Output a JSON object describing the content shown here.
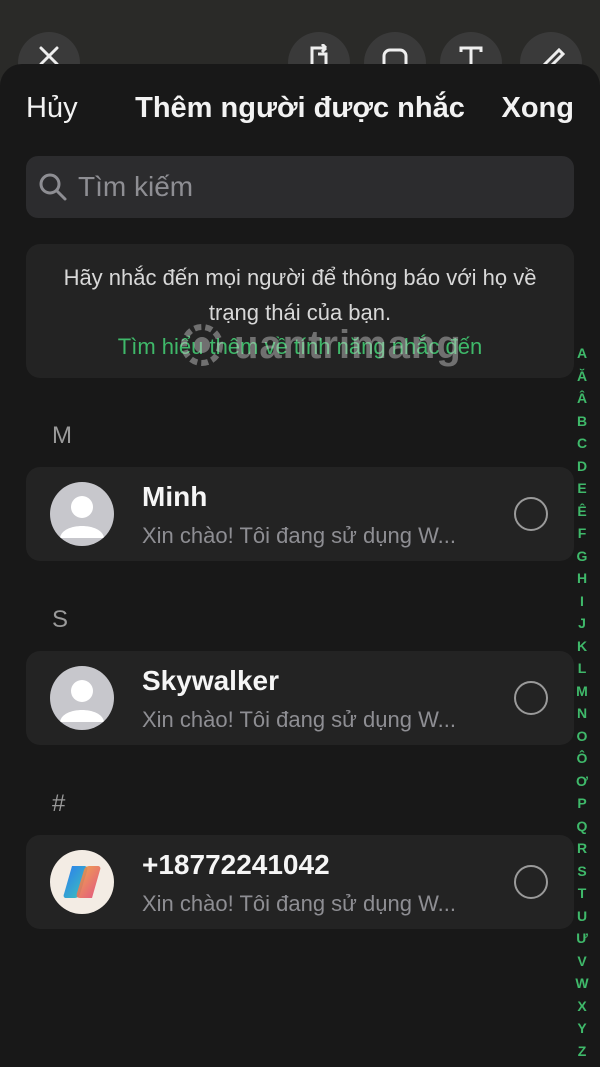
{
  "nav": {
    "cancel_label": "Hủy",
    "title": "Thêm người được nhắc",
    "done_label": "Xong"
  },
  "search": {
    "placeholder": "Tìm kiếm",
    "value": ""
  },
  "info": {
    "text": "Hãy nhắc đến mọi người để thông báo với họ về trạng thái của bạn.",
    "link": "Tìm hiểu thêm về tính năng nhắc đến"
  },
  "watermark": "uantrimang",
  "sections": [
    {
      "letter": "M",
      "contact": {
        "name": "Minh",
        "status": "Xin chào! Tôi đang sử dụng W...",
        "avatar": "person-icon"
      }
    },
    {
      "letter": "S",
      "contact": {
        "name": "Skywalker",
        "status": "Xin chào! Tôi đang sử dụng W...",
        "avatar": "person-icon"
      }
    },
    {
      "letter": "#",
      "contact": {
        "name": "+18772241042",
        "status": "Xin chào! Tôi đang sử dụng W...",
        "avatar": "copilot-logo-icon"
      }
    }
  ],
  "index_letters": [
    "A",
    "Ă",
    "Â",
    "B",
    "C",
    "D",
    "E",
    "Ê",
    "F",
    "G",
    "H",
    "I",
    "J",
    "K",
    "L",
    "M",
    "N",
    "O",
    "Ô",
    "Ơ",
    "P",
    "Q",
    "R",
    "S",
    "T",
    "U",
    "Ư",
    "V",
    "W",
    "X",
    "Y",
    "Z",
    "#"
  ],
  "colors": {
    "accent": "#3fb96a",
    "sheet_bg": "#181818",
    "row_bg": "#232323"
  }
}
